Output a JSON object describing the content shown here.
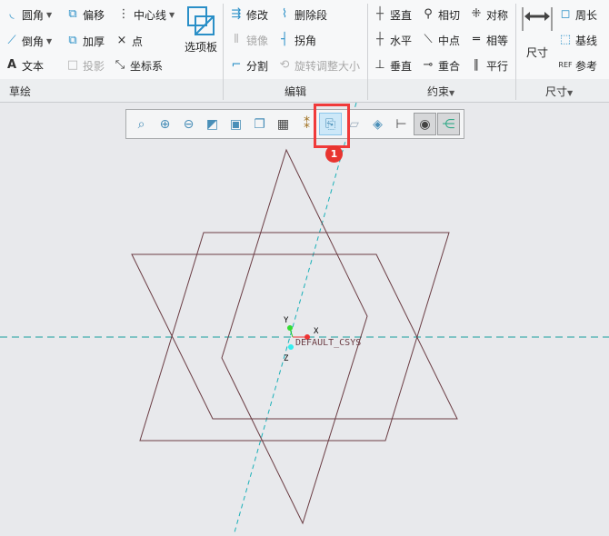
{
  "ribbon": {
    "sketch": {
      "label": "草绘",
      "items": [
        "圆角",
        "偏移",
        "中心线",
        "倒角",
        "加厚",
        "点",
        "文本",
        "投影",
        "坐标系",
        "选项板"
      ]
    },
    "edit": {
      "label": "编辑",
      "items": [
        "修改",
        "删除段",
        "镜像",
        "拐角",
        "分割",
        "旋转调整大小"
      ]
    },
    "constrain": {
      "label": "约束",
      "items": [
        "竖直",
        "相切",
        "对称",
        "水平",
        "中点",
        "相等",
        "垂直",
        "重合",
        "平行"
      ]
    },
    "dimension": {
      "label": "尺寸",
      "items": [
        "尺寸",
        "周长",
        "基线",
        "参考"
      ]
    }
  },
  "toolbar": {
    "icons": [
      "refit-icon",
      "zoom-in-icon",
      "zoom-out-icon",
      "repaint-icon",
      "display-style-icon",
      "saved-views-icon",
      "view-manager-icon",
      "datum-display-icon",
      "sketch-view-icon",
      "section-icon",
      "perspective-icon",
      "dimension-display-icon",
      "sketcher-display-icon",
      "constraint-display-icon"
    ],
    "active": "sketch-view-icon"
  },
  "callout": {
    "number": "1"
  },
  "canvas": {
    "csys_label": "DEFAULT_CSYS",
    "axis_x": "X",
    "axis_y": "Y",
    "axis_z": "Z"
  },
  "colors": {
    "sketch_line": "#6b3d44",
    "centerline": "#1a9e9e",
    "highlight": "#f03a3a",
    "accent": "#2a8fc7"
  }
}
